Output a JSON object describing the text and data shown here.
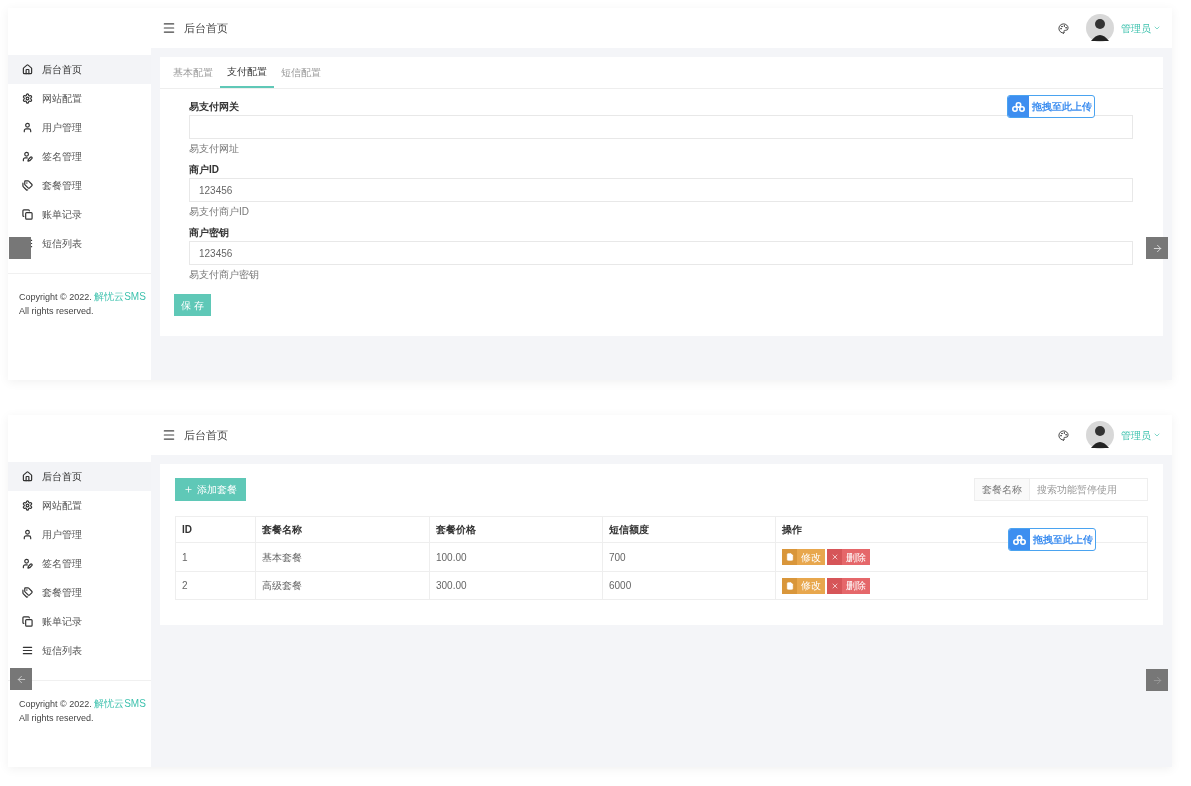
{
  "screens": [
    {
      "kind": "form",
      "header": {
        "title": "后台首页",
        "user": "管理员"
      },
      "sidebar": {
        "items": [
          {
            "label": "后台首页",
            "selected": true
          },
          {
            "label": "网站配置",
            "selected": false
          },
          {
            "label": "用户管理",
            "selected": false
          },
          {
            "label": "签名管理",
            "selected": false
          },
          {
            "label": "套餐管理",
            "selected": false
          },
          {
            "label": "账单记录",
            "selected": false
          },
          {
            "label": "短信列表",
            "selected": false
          }
        ]
      },
      "footer": {
        "copyright": "Copyright © 2022.",
        "brand": "解忧云SMS",
        "rights": "All rights reserved."
      },
      "upload_badge": "拖拽至此上传",
      "tabs": [
        {
          "label": "基本配置",
          "selected": false
        },
        {
          "label": "支付配置",
          "selected": true
        },
        {
          "label": "短信配置",
          "selected": false
        }
      ],
      "fields": [
        {
          "label": "易支付网关",
          "help": "易支付网址"
        },
        {
          "label": "商户ID",
          "value": "123456",
          "help": "易支付商户ID"
        },
        {
          "label": "商户密钥",
          "value": "123456",
          "help": "易支付商户密钥"
        }
      ],
      "save_button": "保 存"
    },
    {
      "kind": "table",
      "header": {
        "title": "后台首页",
        "user": "管理员"
      },
      "sidebar": {
        "items": [
          {
            "label": "后台首页",
            "selected": true
          },
          {
            "label": "网站配置",
            "selected": false
          },
          {
            "label": "用户管理",
            "selected": false
          },
          {
            "label": "签名管理",
            "selected": false
          },
          {
            "label": "套餐管理",
            "selected": false
          },
          {
            "label": "账单记录",
            "selected": false
          },
          {
            "label": "短信列表",
            "selected": false
          }
        ]
      },
      "footer": {
        "copyright": "Copyright © 2022.",
        "brand": "解忧云SMS",
        "rights": "All rights reserved."
      },
      "upload_badge": "拖拽至此上传",
      "add_button": "添加套餐",
      "search": {
        "label": "套餐名称",
        "placeholder": "搜索功能暂停使用"
      },
      "columns": [
        "ID",
        "套餐名称",
        "套餐价格",
        "短信额度",
        "操作"
      ],
      "rows": [
        {
          "cells": [
            "1",
            "基本套餐",
            "100.00",
            "700"
          ],
          "actions": [
            {
              "kind": "edit",
              "label": "修改"
            },
            {
              "kind": "delete",
              "label": "删除"
            }
          ]
        },
        {
          "cells": [
            "2",
            "高级套餐",
            "300.00",
            "6000"
          ],
          "actions": [
            {
              "kind": "edit",
              "label": "修改"
            },
            {
              "kind": "delete",
              "label": "删除"
            }
          ]
        }
      ]
    }
  ]
}
